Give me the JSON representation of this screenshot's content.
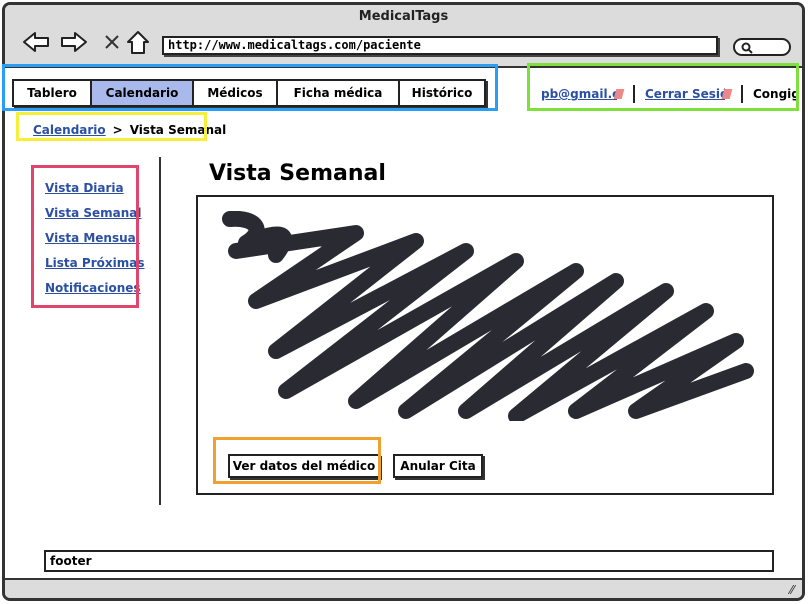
{
  "window": {
    "title": "MedicalTags"
  },
  "browser": {
    "url": "http://www.medicaltags.com/paciente",
    "icons": [
      "back-arrow-icon",
      "forward-arrow-icon",
      "close-icon",
      "home-icon",
      "search-icon"
    ]
  },
  "nav": {
    "tabs": [
      {
        "label": "Tablero"
      },
      {
        "label": "Calendario"
      },
      {
        "label": "Médicos"
      },
      {
        "label": "Ficha médica"
      },
      {
        "label": "Histórico"
      }
    ],
    "active_tab": "Calendario"
  },
  "user": {
    "email": "pb@gmail.com",
    "logout": "Cerrar Sesión",
    "config": "Congig"
  },
  "breadcrumb": {
    "parent": "Calendario",
    "separator": ">",
    "current": "Vista Semanal"
  },
  "sidebar": {
    "items": [
      {
        "label": "Vista Diaria"
      },
      {
        "label": "Vista Semanal"
      },
      {
        "label": "Vista Mensual"
      },
      {
        "label": "Lista Próximas"
      },
      {
        "label": "Notificaciones"
      }
    ]
  },
  "main": {
    "title": "Vista Semanal",
    "image_placeholder": "scribble-placeholder",
    "buttons": {
      "ver_datos": "Ver datos del médico",
      "anular": "Anular Cita"
    }
  },
  "footer": {
    "text": "footer"
  },
  "colors": {
    "active_tab": "#a9b9ec",
    "link": "#2b4fa3",
    "highlight_tabs": "#2a9df4",
    "highlight_user": "#7ee03a",
    "highlight_breadcrumb": "#f5ef3a",
    "highlight_sidebar": "#e0456d",
    "highlight_button": "#f0a030"
  }
}
